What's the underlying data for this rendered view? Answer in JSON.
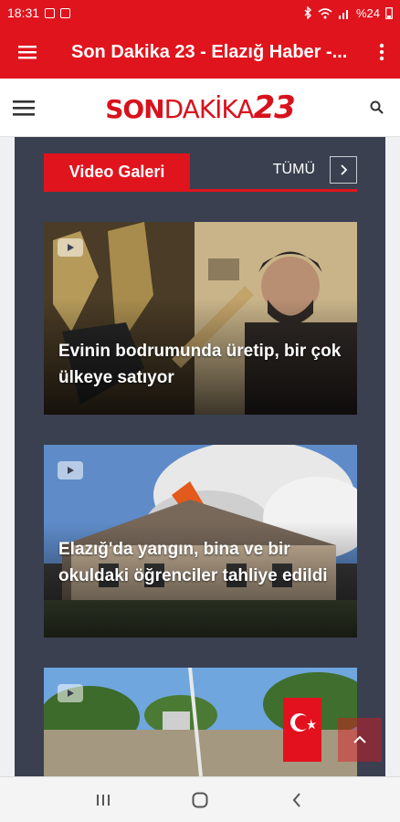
{
  "status_bar": {
    "time": "18:31",
    "battery": "%24"
  },
  "app_bar": {
    "title": "Son Dakika 23 - Elazığ Haber -..."
  },
  "site_header": {
    "logo_part1": "SON",
    "logo_part2": "DAKİKA",
    "logo_part3": "23"
  },
  "section": {
    "title": "Video Galeri",
    "all_label": "TÜMÜ"
  },
  "videos": [
    {
      "title": "Evinin bodrumunda üretip, bir çok ülkeye satıyor"
    },
    {
      "title": "Elazığ'da yangın, bina ve bir okuldaki öğrenciler tahliye edildi"
    },
    {
      "title": ""
    }
  ],
  "icons": {
    "menu": "hamburger-icon",
    "more": "more-vert-icon",
    "search": "search-icon",
    "arrow": "chevron-right-icon",
    "play": "video-play-icon",
    "scroll_top": "chevron-up-icon",
    "nav_recents": "recents-icon",
    "nav_home": "home-icon",
    "nav_back": "back-icon"
  },
  "colors": {
    "brand_red": "#e0141d",
    "panel": "#3a4050"
  }
}
